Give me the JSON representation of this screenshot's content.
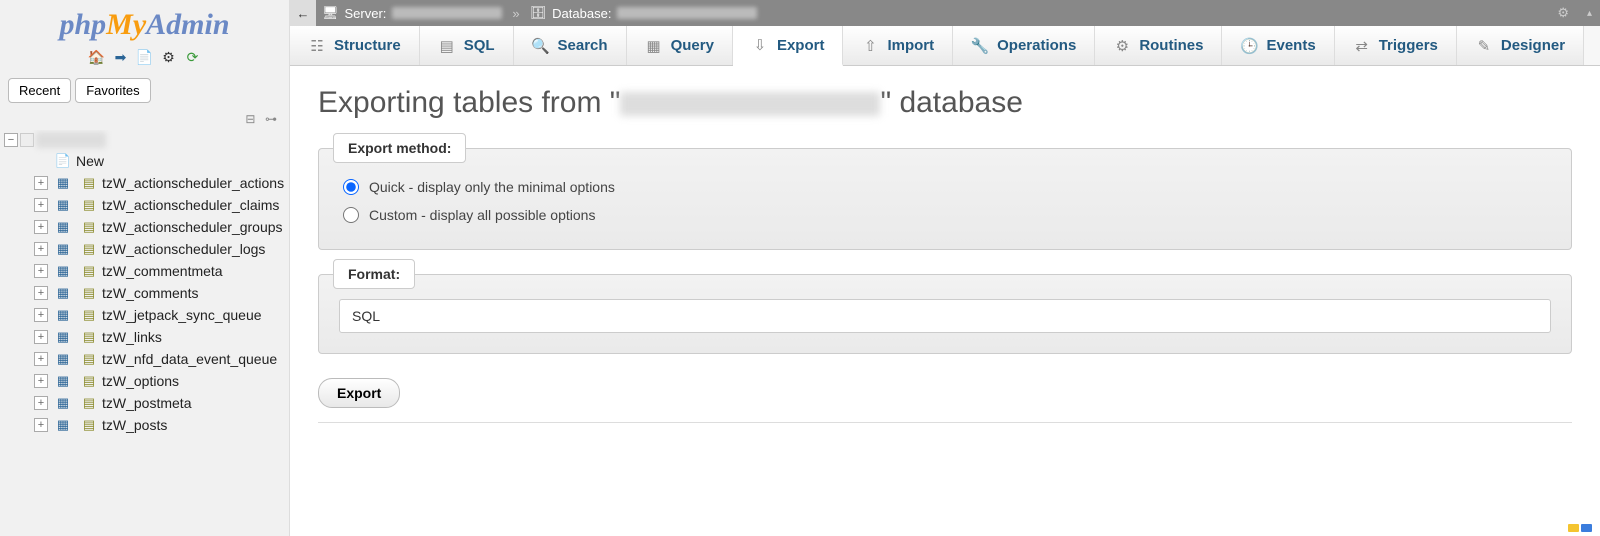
{
  "logo": {
    "part1": "php",
    "part2": "My",
    "part3": "Admin"
  },
  "sidebar_buttons": {
    "recent": "Recent",
    "favorites": "Favorites"
  },
  "tree": {
    "db_name": "(redacted)",
    "new_label": "New",
    "tables": [
      "tzW_actionscheduler_actions",
      "tzW_actionscheduler_claims",
      "tzW_actionscheduler_groups",
      "tzW_actionscheduler_logs",
      "tzW_commentmeta",
      "tzW_comments",
      "tzW_jetpack_sync_queue",
      "tzW_links",
      "tzW_nfd_data_event_queue",
      "tzW_options",
      "tzW_postmeta",
      "tzW_posts"
    ]
  },
  "breadcrumb": {
    "server_label": "Server:",
    "database_label": "Database:"
  },
  "tabs": [
    {
      "label": "Structure",
      "icon": "structure"
    },
    {
      "label": "SQL",
      "icon": "sql"
    },
    {
      "label": "Search",
      "icon": "search"
    },
    {
      "label": "Query",
      "icon": "query"
    },
    {
      "label": "Export",
      "icon": "export"
    },
    {
      "label": "Import",
      "icon": "import"
    },
    {
      "label": "Operations",
      "icon": "operations"
    },
    {
      "label": "Routines",
      "icon": "routines"
    },
    {
      "label": "Events",
      "icon": "events"
    },
    {
      "label": "Triggers",
      "icon": "triggers"
    },
    {
      "label": "Designer",
      "icon": "designer"
    }
  ],
  "active_tab": 4,
  "page": {
    "title_prefix": "Exporting tables from \"",
    "title_suffix": "\" database"
  },
  "export_method": {
    "legend": "Export method:",
    "options": [
      {
        "label": "Quick - display only the minimal options",
        "checked": true
      },
      {
        "label": "Custom - display all possible options",
        "checked": false
      }
    ]
  },
  "format": {
    "legend": "Format:",
    "selected": "SQL"
  },
  "export_button": "Export",
  "tab_icons": {
    "structure": "☷",
    "sql": "▤",
    "search": "🔍",
    "query": "▦",
    "export": "⇩",
    "import": "⇧",
    "operations": "🔧",
    "routines": "⚙",
    "events": "🕒",
    "triggers": "⇄",
    "designer": "✎"
  }
}
